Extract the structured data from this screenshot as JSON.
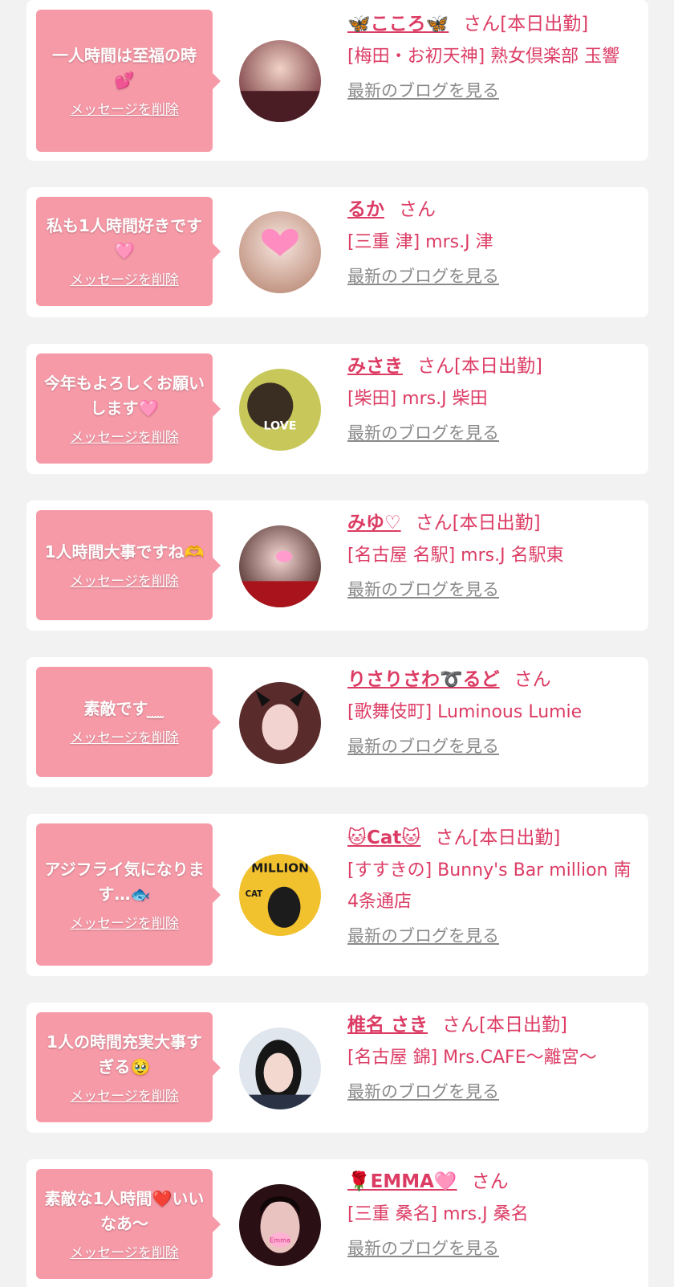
{
  "common": {
    "delete_label": "メッセージを削除",
    "blog_label": "最新のブログを見る"
  },
  "entries": [
    {
      "message": "一人時間は至福の時💕",
      "name": "🦋こころ🦋",
      "suffix": "さん[本日出勤]",
      "shop": "[梅田・お初天神] 熟女倶楽部 玉響"
    },
    {
      "message": "私も1人時間好きです🩷",
      "name": "るか",
      "suffix": "さん",
      "shop": "[三重 津] mrs.J 津"
    },
    {
      "message": "今年もよろしくお願いします🩷",
      "name": "みさき",
      "suffix": "さん[本日出勤]",
      "shop": "[柴田] mrs.J 柴田"
    },
    {
      "message": "1人時間大事ですね🫶",
      "name": "みゆ♡",
      "suffix": "さん[本日出勤]",
      "shop": "[名古屋 名駅] mrs.J 名駅東"
    },
    {
      "message": "素敵です ̫ ̫ ̫",
      "name": "りさりさわ➰るど",
      "suffix": "さん",
      "shop": "[歌舞伎町] Luminous Lumie"
    },
    {
      "message": "アジフライ気になります…🐟",
      "name": "🐱Cat🐱",
      "suffix": "さん[本日出勤]",
      "shop": "[すすきの] Bunny's Bar million 南4条通店"
    },
    {
      "message": "1人の時間充実大事すぎる🥹",
      "name": "椎名 さき",
      "suffix": "さん[本日出勤]",
      "shop": "[名古屋 錦] Mrs.CAFE〜離宮〜"
    },
    {
      "message": "素敵な1人時間❤️いいなあ〜",
      "name": "🌹EMMA🩷",
      "suffix": "さん",
      "shop": "[三重 桑名] mrs.J 桑名"
    }
  ],
  "avatar_texts": {
    "love": "LOVE",
    "cat": "CAT",
    "million": "MILLION",
    "emma": "Emma"
  },
  "colors": {
    "accent": "#dc3c64",
    "bubble": "#f79aa8",
    "background": "#f2f2f2"
  }
}
